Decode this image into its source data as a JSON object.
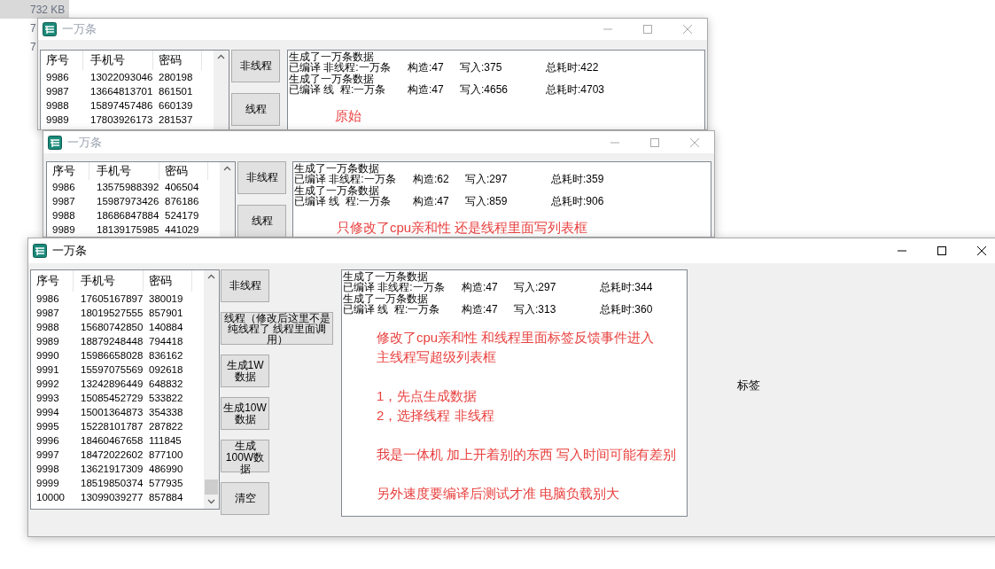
{
  "background_files": [
    {
      "text": "732 KB",
      "selected": true
    },
    {
      "text": "7",
      "selected": false
    },
    {
      "text": "7",
      "selected": false
    }
  ],
  "windows": [
    {
      "title": "一万条",
      "active": false,
      "list": {
        "columns": [
          "序号",
          "手机号",
          "密码"
        ],
        "rows": [
          [
            "9986",
            "13022093046",
            "280198"
          ],
          [
            "9987",
            "13664813701",
            "861501"
          ],
          [
            "9988",
            "15897457486",
            "660139"
          ],
          [
            "9989",
            "17803926173",
            "281537"
          ]
        ]
      },
      "buttons": [
        {
          "label": "非线程",
          "kind": "normal"
        },
        {
          "label": "线程",
          "kind": "normal"
        }
      ],
      "log": [
        {
          "kind": "text",
          "text": "生成了一万条数据"
        },
        {
          "kind": "stats",
          "parts": [
            "已编译 非线程:一万条",
            "构造:47",
            "写入:375",
            "总耗时:422"
          ]
        },
        {
          "kind": "text",
          "text": "生成了一万条数据"
        },
        {
          "kind": "stats",
          "parts": [
            "已编译 线  程:一万条",
            "构造:47",
            "写入:4656",
            "总耗时:4703"
          ]
        }
      ],
      "note": [
        [
          "原始"
        ]
      ]
    },
    {
      "title": "一万条",
      "active": false,
      "list": {
        "columns": [
          "序号",
          "手机号",
          "密码"
        ],
        "rows": [
          [
            "9986",
            "13575988392",
            "406504"
          ],
          [
            "9987",
            "15987973426",
            "876186"
          ],
          [
            "9988",
            "18686847884",
            "524179"
          ],
          [
            "9989",
            "18139175985",
            "441029"
          ]
        ]
      },
      "buttons": [
        {
          "label": "非线程",
          "kind": "normal"
        },
        {
          "label": "线程",
          "kind": "normal"
        }
      ],
      "log": [
        {
          "kind": "text",
          "text": "生成了一万条数据"
        },
        {
          "kind": "stats",
          "parts": [
            "已编译 非线程:一万条",
            "构造:62",
            "写入:297",
            "总耗时:359"
          ]
        },
        {
          "kind": "text",
          "text": "生成了一万条数据"
        },
        {
          "kind": "stats",
          "parts": [
            "已编译 线  程:一万条",
            "构造:47",
            "写入:859",
            "总耗时:906"
          ]
        }
      ],
      "note": [
        [
          "只修改了cpu亲和性 还是线程里面写列表框"
        ]
      ]
    },
    {
      "title": "一万条",
      "active": true,
      "list": {
        "columns": [
          "序号",
          "手机号",
          "密码"
        ],
        "rows": [
          [
            "9986",
            "17605167897",
            "380019"
          ],
          [
            "9987",
            "18019527555",
            "857901"
          ],
          [
            "9988",
            "15680742850",
            "140884"
          ],
          [
            "9989",
            "18879248448",
            "794418"
          ],
          [
            "9990",
            "15986658028",
            "836162"
          ],
          [
            "9991",
            "15597075569",
            "092618"
          ],
          [
            "9992",
            "13242896449",
            "648832"
          ],
          [
            "9993",
            "15085452729",
            "533822"
          ],
          [
            "9994",
            "15001364873",
            "354338"
          ],
          [
            "9995",
            "15228101787",
            "287822"
          ],
          [
            "9996",
            "18460467658",
            "111845"
          ],
          [
            "9997",
            "18472022602",
            "877100"
          ],
          [
            "9998",
            "13621917309",
            "486990"
          ],
          [
            "9999",
            "18519850374",
            "577935"
          ],
          [
            "10000",
            "13099039277",
            "857884"
          ]
        ]
      },
      "buttons": [
        {
          "label": "非线程",
          "kind": "normal"
        },
        {
          "label": "线程（修改后这里不是纯线程了 线程里面调用）",
          "kind": "wide"
        },
        {
          "label": "生成1W数据",
          "kind": "normal"
        },
        {
          "label": "生成10W数据",
          "kind": "normal"
        },
        {
          "label": "生成100W数据",
          "kind": "normal"
        },
        {
          "label": "清空",
          "kind": "normal"
        }
      ],
      "log": [
        {
          "kind": "text",
          "text": "生成了一万条数据"
        },
        {
          "kind": "stats",
          "parts": [
            "已编译 非线程:一万条",
            "构造:47",
            "写入:297",
            "总耗时:344"
          ]
        },
        {
          "kind": "text",
          "text": "生成了一万条数据"
        },
        {
          "kind": "stats",
          "parts": [
            "已编译 线  程:一万条",
            "构造:47",
            "写入:313",
            "总耗时:360"
          ]
        }
      ],
      "note": [
        [
          "修改了cpu亲和性 和线程里面标签反馈事件进入",
          "主线程写超级列表框"
        ],
        [
          "1，先点生成数据",
          "2，选择线程 非线程"
        ],
        [
          "我是一体机 加上开着别的东西 写入时间可能有差别"
        ],
        [
          "另外速度要编译后测试才准 电脑负载别大"
        ]
      ],
      "label": "标签"
    }
  ]
}
